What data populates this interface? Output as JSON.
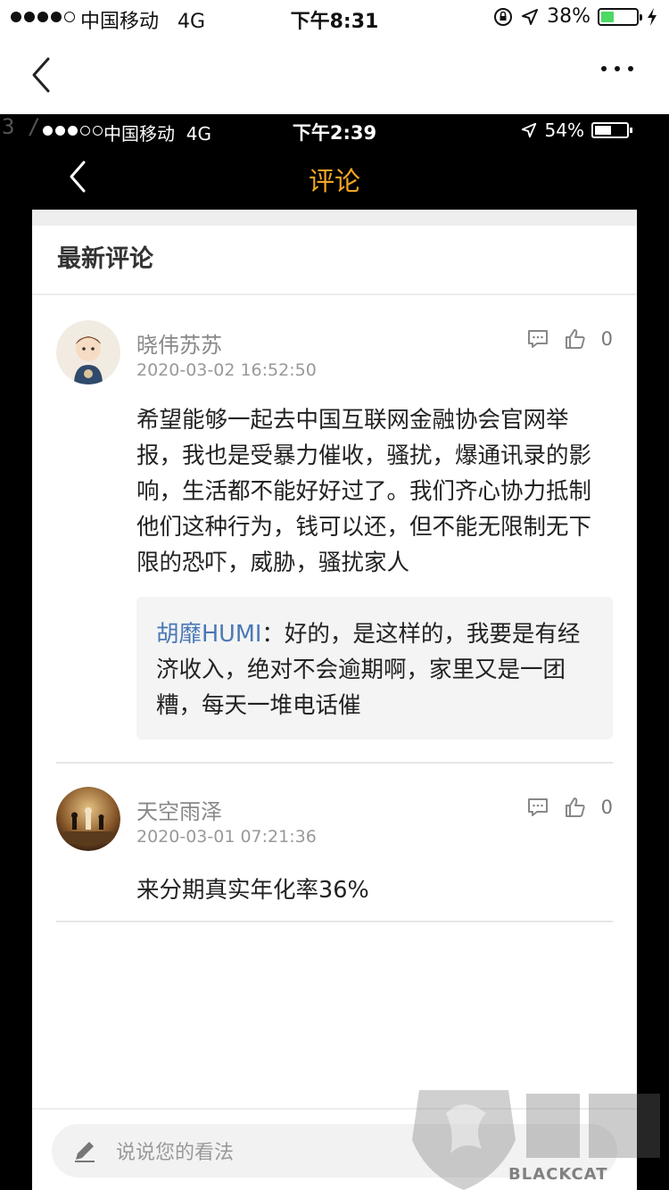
{
  "status_bar": {
    "carrier": "中国移动",
    "network": "4G",
    "time": "下午8:31",
    "battery": "38%",
    "battery_level": 0.38
  },
  "inner_status_bar": {
    "carrier": "中国移动",
    "network": "4G",
    "time": "下午2:39",
    "battery": "54%",
    "battery_level": 0.54
  },
  "page_indicator": "3 /",
  "inner_nav": {
    "title": "评论"
  },
  "section": {
    "title": "最新评论"
  },
  "comments": [
    {
      "name": "晓伟苏苏",
      "time": "2020-03-02 16:52:50",
      "likes": "0",
      "body": "希望能够一起去中国互联网金融协会官网举报，我也是受暴力催收，骚扰，爆通讯录的影响，生活都不能好好过了。我们齐心协力抵制他们这种行为，钱可以还，但不能无限制无下限的恐吓，威胁，骚扰家人",
      "reply": {
        "author": "胡靡HUMI",
        "sep": "：",
        "text": "好的，是这样的，我要是有经济收入，绝对不会逾期啊，家里又是一团糟，每天一堆电话催"
      }
    },
    {
      "name": "天空雨泽",
      "time": "2020-03-01 07:21:36",
      "likes": "0",
      "body": "来分期真实年化率36%"
    }
  ],
  "input": {
    "placeholder": "说说您的看法"
  },
  "watermark": {
    "text": "BLACKCAT"
  },
  "colors": {
    "accent": "#f5a623",
    "reply_author": "#4a78b6"
  },
  "icons": [
    "back-chevron-icon",
    "more-dots-icon",
    "comment-icon",
    "thumbs-up-icon",
    "pencil-icon",
    "location-arrow-icon",
    "orientation-lock-icon",
    "charging-bolt-icon"
  ]
}
